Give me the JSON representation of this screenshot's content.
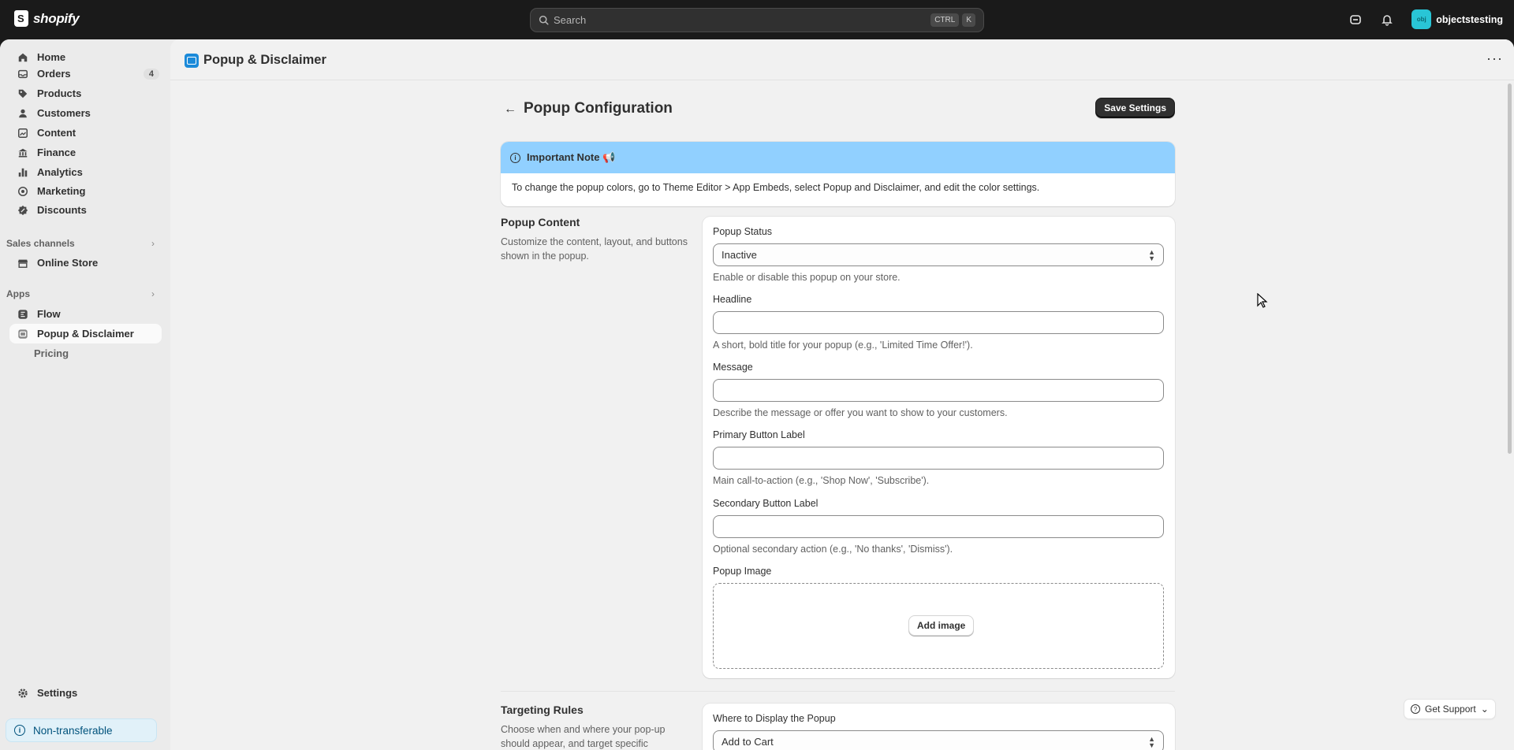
{
  "topbar": {
    "brand": "shopify",
    "search_placeholder": "Search",
    "shortcut_keys": [
      "CTRL",
      "K"
    ],
    "store_initials": "obj",
    "store_name": "objectstesting"
  },
  "sidebar": {
    "items": [
      {
        "label": "Home",
        "icon": "home-icon"
      },
      {
        "label": "Orders",
        "icon": "orders-icon",
        "badge": "4"
      },
      {
        "label": "Products",
        "icon": "tag-icon"
      },
      {
        "label": "Customers",
        "icon": "person-icon"
      },
      {
        "label": "Content",
        "icon": "content-icon"
      },
      {
        "label": "Finance",
        "icon": "bank-icon"
      },
      {
        "label": "Analytics",
        "icon": "bar-chart-icon"
      },
      {
        "label": "Marketing",
        "icon": "target-icon"
      },
      {
        "label": "Discounts",
        "icon": "discount-icon"
      }
    ],
    "sales_channels_label": "Sales channels",
    "online_store": "Online Store",
    "apps_label": "Apps",
    "flow": "Flow",
    "popup_app": "Popup & Disclaimer",
    "pricing": "Pricing",
    "settings": "Settings",
    "non_transferable": "Non-transferable"
  },
  "app_header": {
    "title": "Popup & Disclaimer",
    "more": "···"
  },
  "page": {
    "title": "Popup Configuration",
    "save_button": "Save Settings"
  },
  "note": {
    "title": "Important Note 📢",
    "body": "To change the popup colors, go to Theme Editor > App Embeds, select Popup and Disclaimer, and edit the color settings."
  },
  "popup_content": {
    "title": "Popup Content",
    "description": "Customize the content, layout, and buttons shown in the popup.",
    "status_label": "Popup Status",
    "status_value": "Inactive",
    "status_help": "Enable or disable this popup on your store.",
    "headline_label": "Headline",
    "headline_value": "",
    "headline_help": "A short, bold title for your popup (e.g., 'Limited Time Offer!').",
    "message_label": "Message",
    "message_value": "",
    "message_help": "Describe the message or offer you want to show to your customers.",
    "primary_label": "Primary Button Label",
    "primary_value": "",
    "primary_help": "Main call-to-action (e.g., 'Shop Now', 'Subscribe').",
    "secondary_label": "Secondary Button Label",
    "secondary_value": "",
    "secondary_help": "Optional secondary action (e.g., 'No thanks', 'Dismiss').",
    "image_label": "Popup Image",
    "add_image_button": "Add image"
  },
  "targeting": {
    "title": "Targeting Rules",
    "description": "Choose when and where your pop-up should appear, and target specific",
    "where_label": "Where to Display the Popup",
    "where_value": "Add to Cart"
  },
  "support": {
    "label": "Get Support"
  }
}
